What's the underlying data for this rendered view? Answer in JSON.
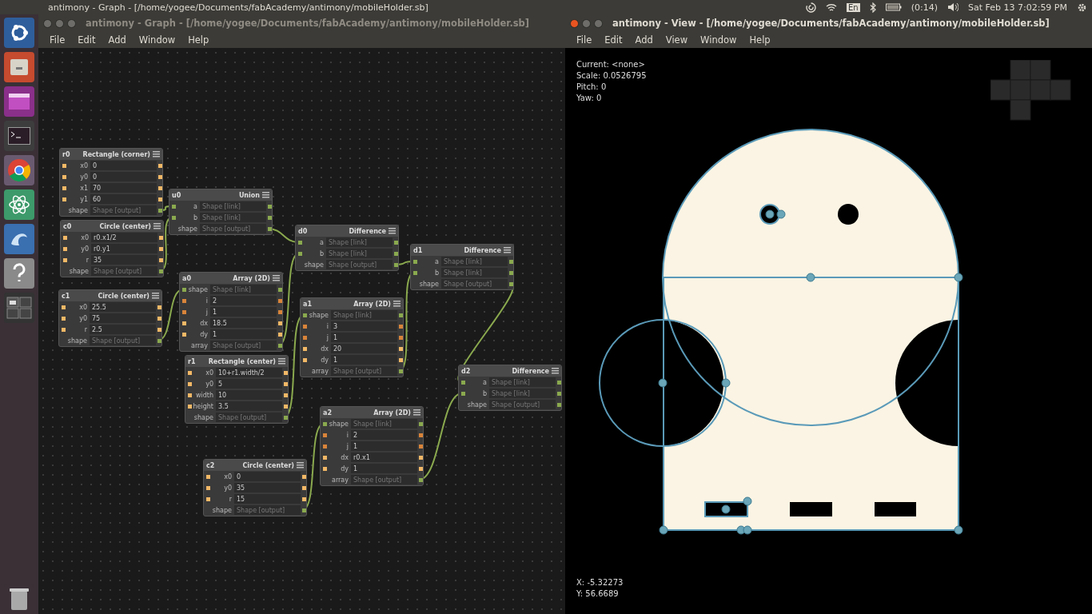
{
  "top_panel": {
    "active_window_title": "antimony - Graph - [/home/yogee/Documents/fabAcademy/antimony/mobileHolder.sb]",
    "keyboard_layout": "En",
    "battery_time": "(0:14)",
    "clock": "Sat Feb 13 7:02:59 PM"
  },
  "graph_window": {
    "title": "antimony - Graph - [/home/yogee/Documents/fabAcademy/antimony/mobileHolder.sb]",
    "focused": false,
    "menu": [
      "File",
      "Edit",
      "Add",
      "Window",
      "Help"
    ],
    "nodes": [
      {
        "id": "r0",
        "title": "Rectangle (corner)",
        "fields": [
          {
            "label": "x0",
            "value": "0",
            "kind": "float"
          },
          {
            "label": "y0",
            "value": "0",
            "kind": "float"
          },
          {
            "label": "x1",
            "value": "70",
            "kind": "float"
          },
          {
            "label": "y1",
            "value": "60",
            "kind": "float"
          },
          {
            "label": "shape",
            "placeholder": "Shape [output]",
            "kind": "output"
          }
        ]
      },
      {
        "id": "u0",
        "title": "Union",
        "fields": [
          {
            "label": "a",
            "placeholder": "Shape [link]",
            "kind": "shape"
          },
          {
            "label": "b",
            "placeholder": "Shape [link]",
            "kind": "shape"
          },
          {
            "label": "shape",
            "placeholder": "Shape [output]",
            "kind": "output"
          }
        ]
      },
      {
        "id": "c0",
        "title": "Circle (center)",
        "fields": [
          {
            "label": "x0",
            "value": "r0.x1/2",
            "kind": "float"
          },
          {
            "label": "y0",
            "value": "r0.y1",
            "kind": "float"
          },
          {
            "label": "r",
            "value": "35",
            "kind": "float"
          },
          {
            "label": "shape",
            "placeholder": "Shape [output]",
            "kind": "output"
          }
        ]
      },
      {
        "id": "d0",
        "title": "Difference",
        "fields": [
          {
            "label": "a",
            "placeholder": "Shape [link]",
            "kind": "shape"
          },
          {
            "label": "b",
            "placeholder": "Shape [link]",
            "kind": "shape"
          },
          {
            "label": "shape",
            "placeholder": "Shape [output]",
            "kind": "output"
          }
        ]
      },
      {
        "id": "d1",
        "title": "Difference",
        "fields": [
          {
            "label": "a",
            "placeholder": "Shape [link]",
            "kind": "shape"
          },
          {
            "label": "b",
            "placeholder": "Shape [link]",
            "kind": "shape"
          },
          {
            "label": "shape",
            "placeholder": "Shape [output]",
            "kind": "output"
          }
        ]
      },
      {
        "id": "a0",
        "title": "Array (2D)",
        "fields": [
          {
            "label": "shape",
            "placeholder": "Shape [link]",
            "kind": "shape"
          },
          {
            "label": "i",
            "value": "2",
            "kind": "int"
          },
          {
            "label": "j",
            "value": "1",
            "kind": "int"
          },
          {
            "label": "dx",
            "value": "18.5",
            "kind": "float"
          },
          {
            "label": "dy",
            "value": "1",
            "kind": "float"
          },
          {
            "label": "array",
            "placeholder": "Shape [output]",
            "kind": "output"
          }
        ]
      },
      {
        "id": "c1",
        "title": "Circle (center)",
        "fields": [
          {
            "label": "x0",
            "value": "25.5",
            "kind": "float"
          },
          {
            "label": "y0",
            "value": "75",
            "kind": "float"
          },
          {
            "label": "r",
            "value": "2.5",
            "kind": "float"
          },
          {
            "label": "shape",
            "placeholder": "Shape [output]",
            "kind": "output"
          }
        ]
      },
      {
        "id": "a1",
        "title": "Array (2D)",
        "fields": [
          {
            "label": "shape",
            "placeholder": "Shape [link]",
            "kind": "shape"
          },
          {
            "label": "i",
            "value": "3",
            "kind": "int"
          },
          {
            "label": "j",
            "value": "1",
            "kind": "int"
          },
          {
            "label": "dx",
            "value": "20",
            "kind": "float"
          },
          {
            "label": "dy",
            "value": "1",
            "kind": "float"
          },
          {
            "label": "array",
            "placeholder": "Shape [output]",
            "kind": "output"
          }
        ]
      },
      {
        "id": "r1",
        "title": "Rectangle (center)",
        "fields": [
          {
            "label": "x0",
            "value": "10+r1.width/2",
            "kind": "float"
          },
          {
            "label": "y0",
            "value": "5",
            "kind": "float"
          },
          {
            "label": "width",
            "value": "10",
            "kind": "float"
          },
          {
            "label": "height",
            "value": "3.5",
            "kind": "float"
          },
          {
            "label": "shape",
            "placeholder": "Shape [output]",
            "kind": "output"
          }
        ]
      },
      {
        "id": "d2",
        "title": "Difference",
        "fields": [
          {
            "label": "a",
            "placeholder": "Shape [link]",
            "kind": "shape"
          },
          {
            "label": "b",
            "placeholder": "Shape [link]",
            "kind": "shape"
          },
          {
            "label": "shape",
            "placeholder": "Shape [output]",
            "kind": "output"
          }
        ]
      },
      {
        "id": "a2",
        "title": "Array (2D)",
        "fields": [
          {
            "label": "shape",
            "placeholder": "Shape [link]",
            "kind": "shape"
          },
          {
            "label": "i",
            "value": "2",
            "kind": "int"
          },
          {
            "label": "j",
            "value": "1",
            "kind": "int"
          },
          {
            "label": "dx",
            "value": "r0.x1",
            "kind": "float"
          },
          {
            "label": "dy",
            "value": "1",
            "kind": "float"
          },
          {
            "label": "array",
            "placeholder": "Shape [output]",
            "kind": "output"
          }
        ]
      },
      {
        "id": "c2",
        "title": "Circle (center)",
        "fields": [
          {
            "label": "x0",
            "value": "0",
            "kind": "float"
          },
          {
            "label": "y0",
            "value": "35",
            "kind": "float"
          },
          {
            "label": "r",
            "value": "15",
            "kind": "float"
          },
          {
            "label": "shape",
            "placeholder": "Shape [output]",
            "kind": "output"
          }
        ]
      }
    ]
  },
  "view_window": {
    "title": "antimony - View - [/home/yogee/Documents/fabAcademy/antimony/mobileHolder.sb]",
    "focused": true,
    "menu": [
      "File",
      "Edit",
      "Add",
      "View",
      "Window",
      "Help"
    ],
    "info": [
      "Current: <none>",
      "Scale: 0.0526795",
      "Pitch: 0",
      "Yaw: 0"
    ],
    "cursor": [
      "X: -5.32273",
      "Y: 56.6689"
    ]
  }
}
